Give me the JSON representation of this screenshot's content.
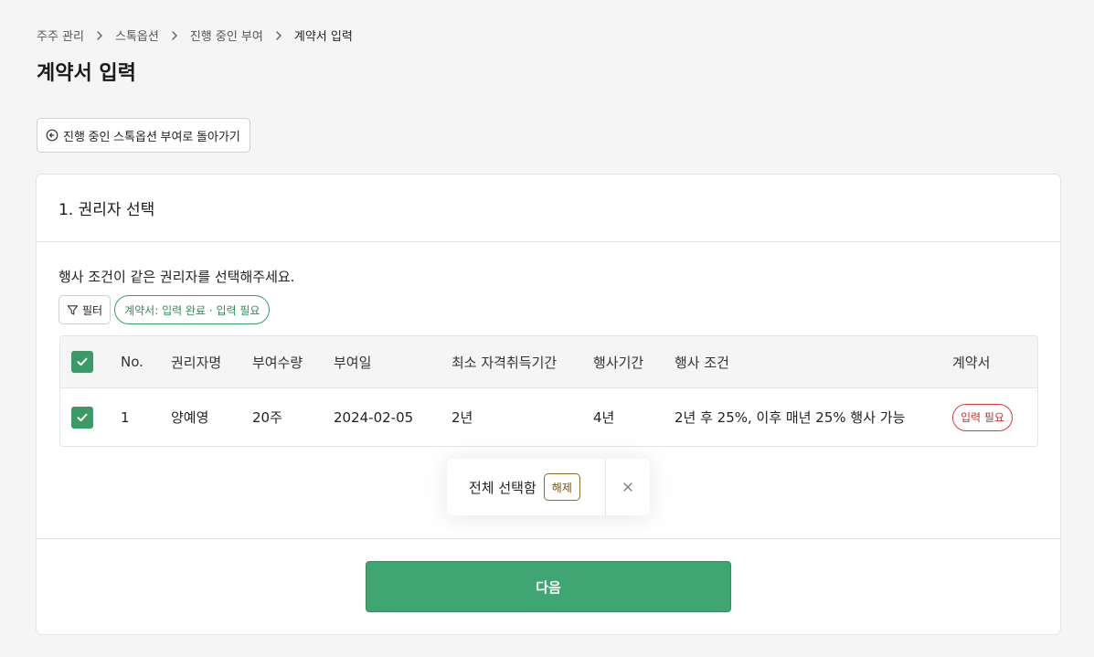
{
  "breadcrumb": [
    "주주 관리",
    "스톡옵션",
    "진행 중인 부여",
    "계약서 입력"
  ],
  "page_title": "계약서 입력",
  "back_button_label": "진행 중인 스톡옵션 부여로 돌아가기",
  "section_title": "1. 권리자 선택",
  "instruction": "행사 조건이 같은 권리자를 선택해주세요.",
  "filter": {
    "button_label": "필터",
    "chip_label": "계약서: 입력 완료 · 입력 필요"
  },
  "table": {
    "header_checked": true,
    "columns": [
      "No.",
      "권리자명",
      "부여수량",
      "부여일",
      "최소 자격취득기간",
      "행사기간",
      "행사 조건",
      "계약서"
    ],
    "rows": [
      {
        "checked": true,
        "no": "1",
        "name": "양예영",
        "quantity": "20주",
        "grant_date": "2024-02-05",
        "vesting": "2년",
        "exercise_period": "4년",
        "condition": "2년 후 25%, 이후 매년 25% 행사 가능",
        "contract_status": "입력 필요"
      }
    ]
  },
  "next_button_label": "다음",
  "toast": {
    "text": "전체 선택함",
    "action_label": "해제"
  },
  "colors": {
    "primary": "#3fa572",
    "danger": "#d8393b",
    "warning": "#8a6b1e"
  }
}
